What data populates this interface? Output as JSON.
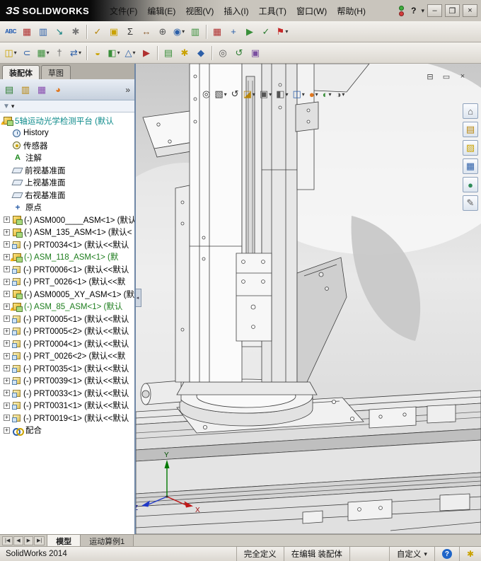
{
  "ui": {
    "caret": "▾"
  },
  "titlebar": {
    "logo_mark": "ЗS",
    "logo_text": "SOLIDWORKS",
    "menus": [
      "文件(F)",
      "编辑(E)",
      "视图(V)",
      "插入(I)",
      "工具(T)",
      "窗口(W)",
      "帮助(H)"
    ],
    "controls": {
      "help": "?",
      "minimize": "–",
      "maximize": "❐",
      "close": "×"
    }
  },
  "toolbar1": {
    "icons": [
      {
        "name": "spell-check",
        "glyph": "ABC",
        "color": "#1a56b0"
      },
      {
        "name": "design-binder",
        "glyph": "▦",
        "color": "#b03030"
      },
      {
        "name": "task-scheduler",
        "glyph": "▥",
        "color": "#2c5fa8"
      },
      {
        "name": "export-data",
        "glyph": "↘",
        "color": "#0a7d7d"
      },
      {
        "name": "options",
        "glyph": "✱",
        "color": "#777777"
      },
      {
        "sep": true
      },
      {
        "name": "design-checker",
        "glyph": "✓",
        "color": "#b8860b"
      },
      {
        "name": "costing",
        "glyph": "▣",
        "color": "#caa200"
      },
      {
        "name": "equations",
        "glyph": "Σ",
        "color": "#333333"
      },
      {
        "name": "measure",
        "glyph": "↔",
        "color": "#8a5a2b"
      },
      {
        "name": "mass-properties",
        "glyph": "⊕",
        "color": "#555555"
      },
      {
        "name": "interference-detection",
        "glyph": "◉",
        "color": "#2c5fa8",
        "dropdown": true
      },
      {
        "name": "assembly-statistics",
        "glyph": "▥",
        "color": "#3a8f3a"
      },
      {
        "sep": true
      },
      {
        "name": "design-table",
        "glyph": "▦",
        "color": "#b03030"
      },
      {
        "name": "coordinate-system",
        "glyph": "+",
        "color": "#2c5fa8"
      },
      {
        "name": "animation",
        "glyph": "▶",
        "color": "#3a8f3a"
      },
      {
        "name": "check-model",
        "glyph": "✓",
        "color": "#2e7d32"
      },
      {
        "name": "review-flag",
        "glyph": "⚑",
        "color": "#c62828",
        "dropdown": true
      }
    ]
  },
  "toolbar2": {
    "icons": [
      {
        "name": "insert-component",
        "glyph": "◫",
        "color": "#caa200",
        "dropdown": true
      },
      {
        "name": "mate",
        "glyph": "⊂",
        "color": "#2c5fa8"
      },
      {
        "name": "linear-component-pattern",
        "glyph": "▦",
        "color": "#3a8f3a",
        "dropdown": true
      },
      {
        "name": "smart-fasteners",
        "glyph": "†",
        "color": "#666666"
      },
      {
        "name": "move-component",
        "glyph": "⇄",
        "color": "#2c5fa8",
        "dropdown": true
      },
      {
        "sep": true
      },
      {
        "name": "show-hidden-components",
        "glyph": "◒",
        "color": "#caa200"
      },
      {
        "name": "assembly-features",
        "glyph": "◧",
        "color": "#3a8f3a",
        "dropdown": true
      },
      {
        "name": "reference-geometry",
        "glyph": "△",
        "color": "#2c5fa8",
        "dropdown": true
      },
      {
        "name": "new-motion-study",
        "glyph": "▶",
        "color": "#b03030"
      },
      {
        "sep": true
      },
      {
        "name": "bill-of-materials",
        "glyph": "▤",
        "color": "#3a8f3a"
      },
      {
        "name": "exploded-view",
        "glyph": "✱",
        "color": "#caa200"
      },
      {
        "name": "instant3d",
        "glyph": "◆",
        "color": "#2c5fa8"
      },
      {
        "sep": true
      },
      {
        "name": "large-assembly-mode",
        "glyph": "◎",
        "color": "#555555"
      },
      {
        "name": "rebuild",
        "glyph": "↺",
        "color": "#2e7d32"
      },
      {
        "name": "render-tools",
        "glyph": "▣",
        "color": "#7b4fa0"
      }
    ]
  },
  "left_panel": {
    "tabs": [
      {
        "label": "装配体",
        "active": true
      },
      {
        "label": "草图",
        "active": false
      }
    ],
    "fm_icons": [
      {
        "name": "featuremanager-tree",
        "glyph": "▤",
        "color": "#2e7d32"
      },
      {
        "name": "propertymanager",
        "glyph": "▥",
        "color": "#b8860b"
      },
      {
        "name": "configurationmanager",
        "glyph": "▦",
        "color": "#8a4fb0"
      },
      {
        "name": "displaymanager",
        "glyph": "◕",
        "color": "#e07820"
      }
    ],
    "overflow": "»",
    "filter": {
      "funnel": "▼"
    },
    "collapse": "◂",
    "tree": [
      {
        "label": "5轴运动光学检测平台 (默认",
        "icon": "assembly-root",
        "root": true,
        "warn": true,
        "color": "#0c8a8a"
      },
      {
        "label": "History",
        "icon": "history"
      },
      {
        "label": "传感器",
        "icon": "sensor"
      },
      {
        "label": "注解",
        "icon": "annotations"
      },
      {
        "label": "前视基准面",
        "icon": "plane"
      },
      {
        "label": "上视基准面",
        "icon": "plane"
      },
      {
        "label": "右视基准面",
        "icon": "plane"
      },
      {
        "label": "原点",
        "icon": "origin"
      },
      {
        "label": "(-) ASM000____ASM<1> (默认",
        "icon": "assembly",
        "plus": true
      },
      {
        "label": "(-) ASM_135_ASM<1> (默认<",
        "icon": "assembly",
        "plus": true
      },
      {
        "label": "(-) PRT0034<1> (默认<<默认",
        "icon": "part",
        "plus": true
      },
      {
        "label": "(-) ASM_118_ASM<1> (默",
        "icon": "assembly",
        "plus": true,
        "warn": true,
        "color": "#1d7d1d"
      },
      {
        "label": "(-) PRT0006<1> (默认<<默认",
        "icon": "part",
        "plus": true
      },
      {
        "label": "(-) PRT_0026<1> (默认<<默",
        "icon": "part",
        "plus": true
      },
      {
        "label": "(-) ASM0005_XY_ASM<1> (默",
        "icon": "assembly",
        "plus": true
      },
      {
        "label": "(-) ASM_85_ASM<1> (默认",
        "icon": "assembly",
        "plus": true,
        "warn": true,
        "color": "#1d7d1d"
      },
      {
        "label": "(-) PRT0005<1> (默认<<默认",
        "icon": "part",
        "plus": true
      },
      {
        "label": "(-) PRT0005<2> (默认<<默认",
        "icon": "part",
        "plus": true
      },
      {
        "label": "(-) PRT0004<1> (默认<<默认",
        "icon": "part",
        "plus": true
      },
      {
        "label": "(-) PRT_0026<2> (默认<<默",
        "icon": "part",
        "plus": true
      },
      {
        "label": "(-) PRT0035<1> (默认<<默认",
        "icon": "part",
        "plus": true
      },
      {
        "label": "(-) PRT0039<1> (默认<<默认",
        "icon": "part",
        "plus": true
      },
      {
        "label": "(-) PRT0033<1> (默认<<默认",
        "icon": "part",
        "plus": true
      },
      {
        "label": "(-) PRT0031<1> (默认<<默认",
        "icon": "part",
        "plus": true
      },
      {
        "label": "(-) PRT0019<1> (默认<<默认",
        "icon": "part",
        "plus": true
      },
      {
        "label": "配合",
        "icon": "mates",
        "plus": true
      }
    ]
  },
  "viewport": {
    "doc_controls": [
      {
        "name": "doc-minimize",
        "glyph": "⊟",
        "color": "#444444"
      },
      {
        "name": "doc-restore",
        "glyph": "▭",
        "color": "#444444"
      },
      {
        "name": "doc-close",
        "glyph": "×",
        "color": "#444444"
      }
    ],
    "headsup": [
      {
        "name": "zoom-to-fit",
        "glyph": "◎",
        "color": "#333333"
      },
      {
        "name": "zoom-to-area",
        "glyph": "▧",
        "color": "#333333",
        "dropdown": true
      },
      {
        "name": "previous-view",
        "glyph": "↺",
        "color": "#333333"
      },
      {
        "name": "section-view",
        "glyph": "◪",
        "color": "#b8860b",
        "dropdown": true
      },
      {
        "name": "view-orientation",
        "glyph": "▣",
        "color": "#555555",
        "dropdown": true
      },
      {
        "name": "display-style",
        "glyph": "◧",
        "color": "#555555",
        "dropdown": true
      },
      {
        "name": "hide-show-items",
        "glyph": "◫",
        "color": "#2c5fa8",
        "dropdown": true
      },
      {
        "name": "edit-appearance",
        "glyph": "●",
        "color": "#e07820",
        "dropdown": true
      },
      {
        "name": "apply-scene",
        "glyph": "◐",
        "color": "#3a8f3a",
        "dropdown": true
      },
      {
        "name": "view-settings",
        "glyph": "◑",
        "color": "#555555",
        "dropdown": true
      }
    ],
    "taskpane": [
      {
        "name": "solidworks-resources",
        "glyph": "⌂",
        "color": "#555555"
      },
      {
        "name": "design-library",
        "glyph": "▤",
        "color": "#b8860b"
      },
      {
        "name": "file-explorer",
        "glyph": "▨",
        "color": "#caa200"
      },
      {
        "name": "view-palette",
        "glyph": "▦",
        "color": "#2c5fa8"
      },
      {
        "name": "appearances-scenes",
        "glyph": "●",
        "color": "#2e8b57"
      },
      {
        "name": "custom-properties",
        "glyph": "✎",
        "color": "#555555"
      }
    ],
    "triad": {
      "x": "X",
      "y": "Y",
      "z": "Z"
    }
  },
  "bottom_bar": {
    "nav": [
      "|◀",
      "◀",
      "▶",
      "▶|"
    ],
    "tabs": [
      {
        "label": "模型",
        "active": true
      },
      {
        "label": "运动算例1",
        "active": false
      }
    ]
  },
  "statusbar": {
    "app": "SolidWorks 2014",
    "fully_defined": "完全定义",
    "editing": "在编辑 装配体",
    "custom": "自定义",
    "help": "?",
    "tips_glyph": "✱"
  }
}
